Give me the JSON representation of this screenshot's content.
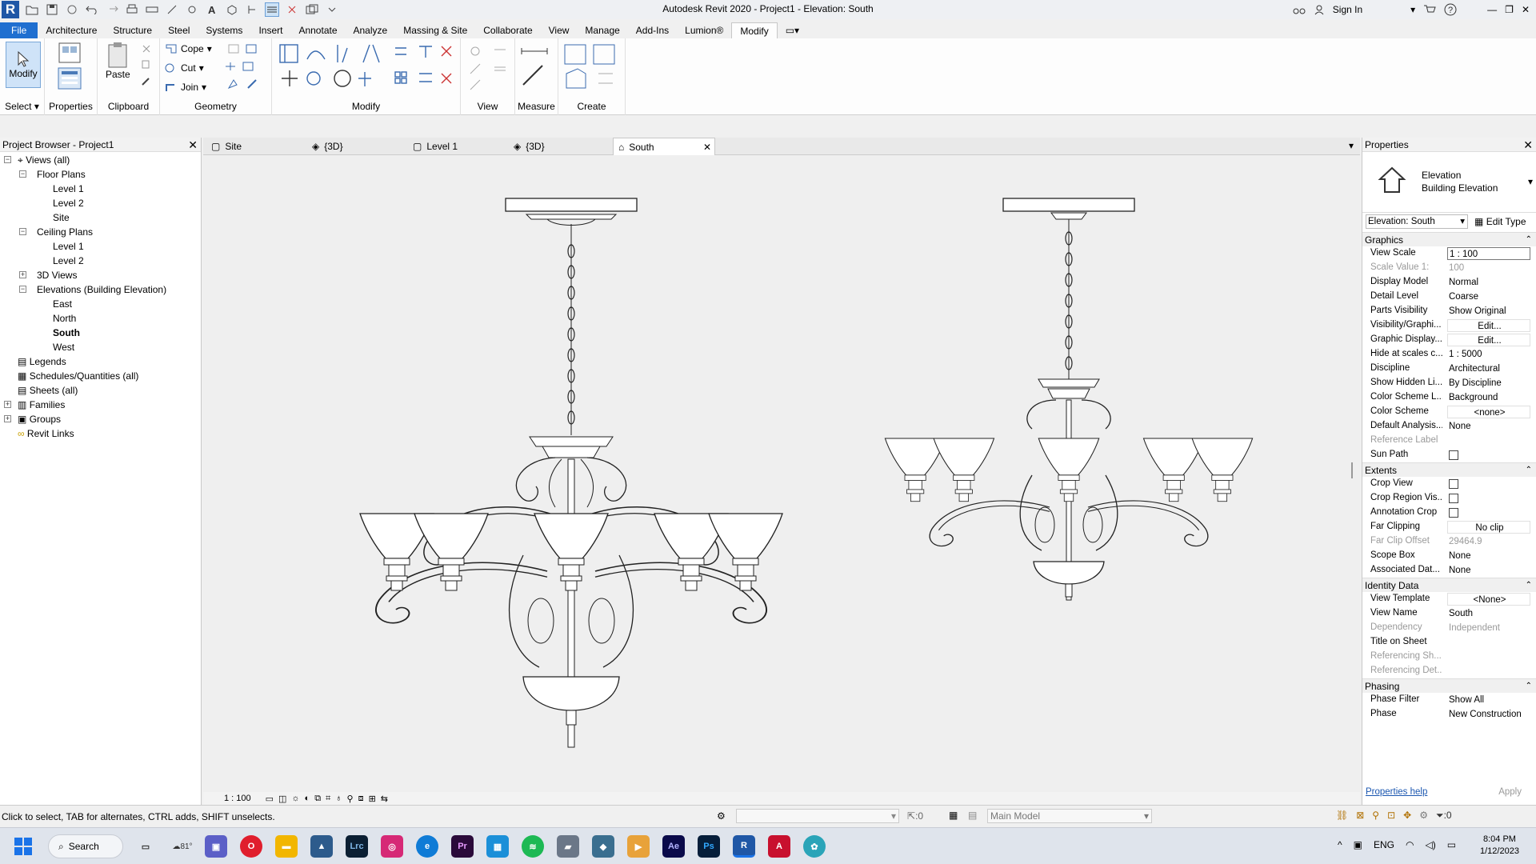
{
  "app": {
    "logo": "R",
    "title": "Autodesk Revit 2020 - Project1 - Elevation: South",
    "sign_in": "Sign In"
  },
  "ribbon_tabs": [
    "File",
    "Architecture",
    "Structure",
    "Steel",
    "Systems",
    "Insert",
    "Annotate",
    "Analyze",
    "Massing & Site",
    "Collaborate",
    "View",
    "Manage",
    "Add-Ins",
    "Lumion®",
    "Modify"
  ],
  "ribbon": {
    "modify_label": "Modify",
    "select_label": "Select",
    "properties_label": "Properties",
    "paste_label": "Paste",
    "clipboard_label": "Clipboard",
    "cope_label": "Cope",
    "cut_label": "Cut",
    "join_label": "Join",
    "geometry_label": "Geometry",
    "modify_panel_label": "Modify",
    "view_label": "View",
    "measure_label": "Measure",
    "create_label": "Create"
  },
  "browser": {
    "title": "Project Browser - Project1",
    "nodes": [
      {
        "label": "Views (all)"
      },
      {
        "label": "Floor Plans"
      },
      {
        "label": "Level 1"
      },
      {
        "label": "Level 2"
      },
      {
        "label": "Site"
      },
      {
        "label": "Ceiling Plans"
      },
      {
        "label": "Level 1"
      },
      {
        "label": "Level 2"
      },
      {
        "label": "3D Views"
      },
      {
        "label": "Elevations (Building Elevation)"
      },
      {
        "label": "East"
      },
      {
        "label": "North"
      },
      {
        "label": "South"
      },
      {
        "label": "West"
      },
      {
        "label": "Legends"
      },
      {
        "label": "Schedules/Quantities (all)"
      },
      {
        "label": "Sheets (all)"
      },
      {
        "label": "Families"
      },
      {
        "label": "Groups"
      },
      {
        "label": "Revit Links"
      }
    ]
  },
  "view_tabs": [
    "Site",
    "{3D}",
    "Level 1",
    "{3D}",
    "South"
  ],
  "view_bar": {
    "scale": "1 : 100"
  },
  "properties": {
    "title": "Properties",
    "type_line1": "Elevation",
    "type_line2": "Building Elevation",
    "selector": "Elevation: South",
    "edit_type": "Edit Type",
    "sections": {
      "graphics": "Graphics",
      "extents": "Extents",
      "identity": "Identity Data",
      "phasing": "Phasing"
    },
    "rows": [
      {
        "k": "View Scale",
        "v": "1 : 100"
      },
      {
        "k": "Scale Value    1:",
        "v": "100"
      },
      {
        "k": "Display Model",
        "v": "Normal"
      },
      {
        "k": "Detail Level",
        "v": "Coarse"
      },
      {
        "k": "Parts Visibility",
        "v": "Show Original"
      },
      {
        "k": "Visibility/Graphi...",
        "v": "Edit..."
      },
      {
        "k": "Graphic Display...",
        "v": "Edit..."
      },
      {
        "k": "Hide at scales c...",
        "v": "1 : 5000"
      },
      {
        "k": "Discipline",
        "v": "Architectural"
      },
      {
        "k": "Show Hidden Li...",
        "v": "By Discipline"
      },
      {
        "k": "Color Scheme L...",
        "v": "Background"
      },
      {
        "k": "Color Scheme",
        "v": "<none>"
      },
      {
        "k": "Default Analysis...",
        "v": "None"
      },
      {
        "k": "Reference Label",
        "v": ""
      },
      {
        "k": "Sun Path",
        "v": ""
      },
      {
        "k": "Crop View",
        "v": ""
      },
      {
        "k": "Crop Region Vis...",
        "v": ""
      },
      {
        "k": "Annotation Crop",
        "v": ""
      },
      {
        "k": "Far Clipping",
        "v": "No clip"
      },
      {
        "k": "Far Clip Offset",
        "v": "29464.9"
      },
      {
        "k": "Scope Box",
        "v": "None"
      },
      {
        "k": "Associated Dat...",
        "v": "None"
      },
      {
        "k": "View Template",
        "v": "<None>"
      },
      {
        "k": "View Name",
        "v": "South"
      },
      {
        "k": "Dependency",
        "v": "Independent"
      },
      {
        "k": "Title on Sheet",
        "v": ""
      },
      {
        "k": "Referencing Sh...",
        "v": ""
      },
      {
        "k": "Referencing Det...",
        "v": ""
      },
      {
        "k": "Phase Filter",
        "v": "Show All"
      },
      {
        "k": "Phase",
        "v": "New Construction"
      }
    ],
    "help": "Properties help",
    "apply": "Apply"
  },
  "status": {
    "hint": "Click to select, TAB for alternates, CTRL adds, SHIFT unselects.",
    "zero": ":0",
    "model": "Main Model",
    "filter_count": ":0"
  },
  "taskbar": {
    "search": "Search",
    "temp": "81°",
    "lang": "ENG",
    "time": "8:04 PM",
    "date": "1/12/2023",
    "apps": [
      "Lrc",
      "Pr",
      "Ae",
      "Ps"
    ]
  }
}
